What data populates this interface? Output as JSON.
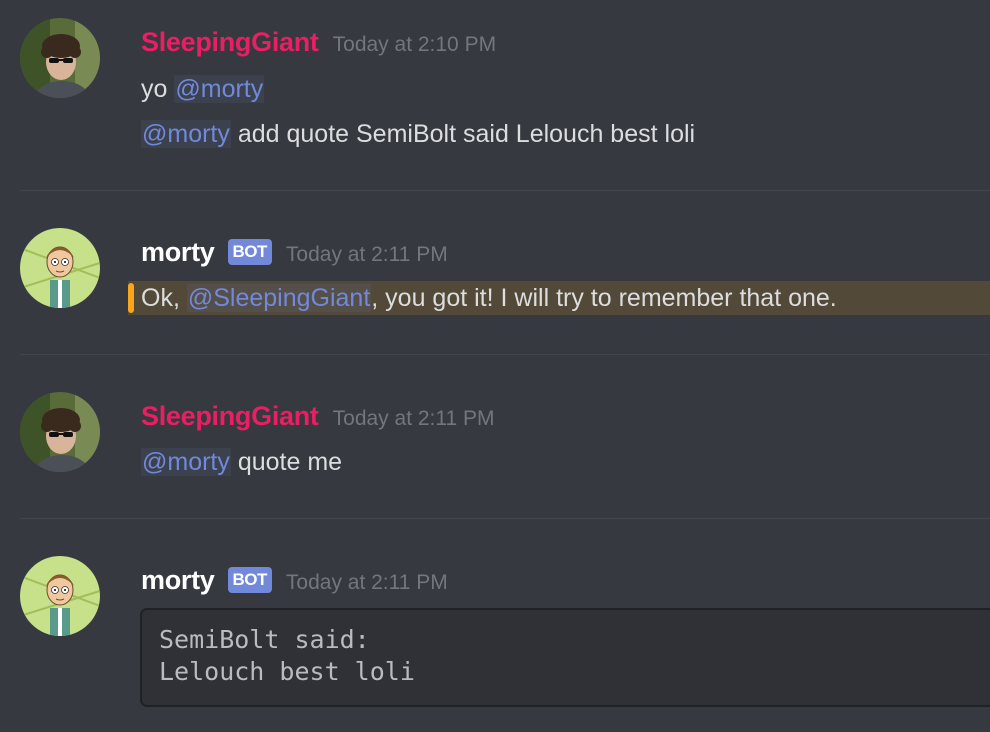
{
  "colors": {
    "background": "#36393f",
    "mention": "#7289da",
    "human_username": "#e91e63",
    "bot_username": "#ffffff",
    "timestamp": "#72767d",
    "message_text": "#dcddde",
    "highlight_bar": "#faa61a",
    "bot_tag": "#7289da",
    "codeblock_bg": "#2f3136"
  },
  "messages": [
    {
      "author": "SleepingGiant",
      "avatar_icon": "user-photo-avatar-icon",
      "timestamp": "Today at 2:10 PM",
      "lines": [
        {
          "prefix": "yo ",
          "mention": "@morty",
          "suffix": ""
        },
        {
          "prefix": "",
          "mention": "@morty",
          "suffix": " add quote SemiBolt said Lelouch best loli"
        }
      ]
    },
    {
      "author": "morty",
      "bot_tag": "BOT",
      "avatar_icon": "morty-cartoon-avatar-icon",
      "timestamp": "Today at 2:11 PM",
      "lines": [
        {
          "prefix": "Ok, ",
          "mention": "@SleepingGiant",
          "suffix": ", you got it! I will try to remember that one."
        }
      ]
    },
    {
      "author": "SleepingGiant",
      "avatar_icon": "user-photo-avatar-icon",
      "timestamp": "Today at 2:11 PM",
      "lines": [
        {
          "prefix": "",
          "mention": "@morty",
          "suffix": " quote me"
        }
      ]
    },
    {
      "author": "morty",
      "bot_tag": "BOT",
      "avatar_icon": "morty-cartoon-avatar-icon",
      "timestamp": "Today at 2:11 PM",
      "codeblock": [
        "SemiBolt said:",
        "Lelouch best loli"
      ]
    }
  ]
}
